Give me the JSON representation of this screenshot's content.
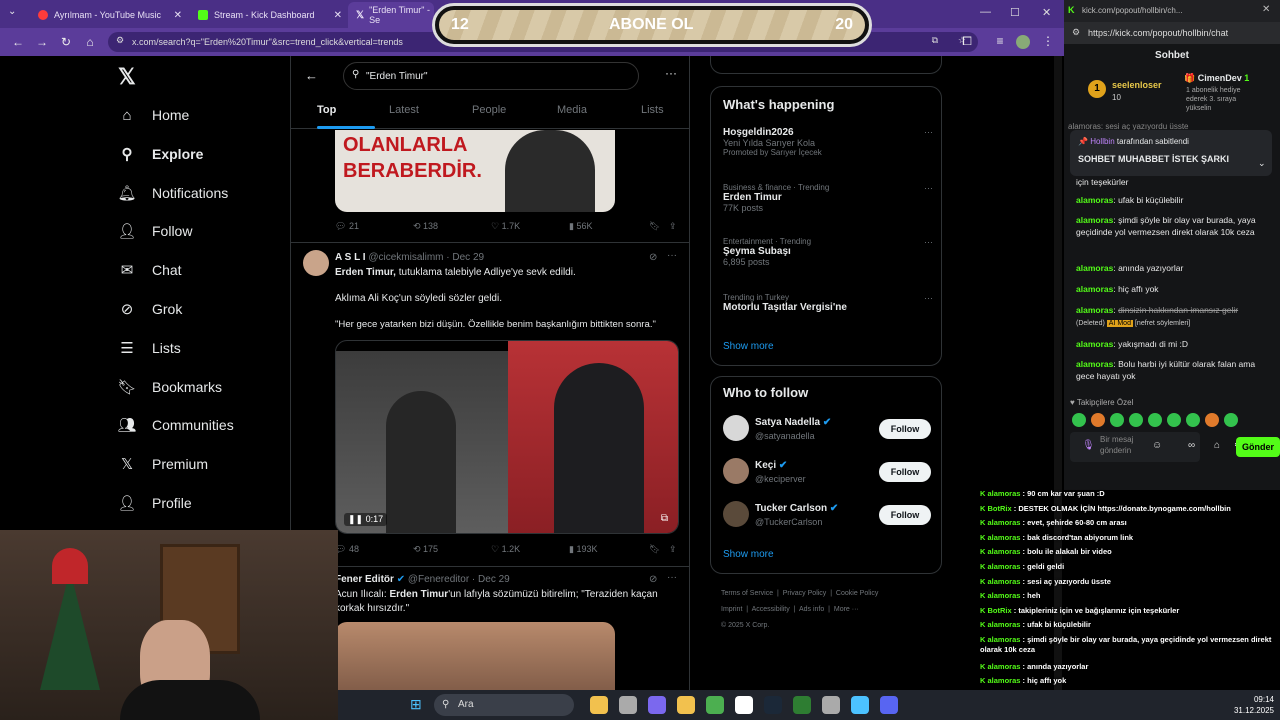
{
  "browser": {
    "tabs": [
      {
        "title": "Ayrılmam - YouTube Music",
        "color": "#ff3b3b"
      },
      {
        "title": "Stream - Kick Dashboard",
        "color": "#53fc18"
      },
      {
        "title": "\"Erden Timur\" - Se",
        "color": "#000000"
      }
    ],
    "url": "x.com/search?q=\"Erden%20Timur\"&src=trend_click&vertical=trends"
  },
  "overlay": {
    "left": "12",
    "label": "ABONE OL",
    "right": "20"
  },
  "x": {
    "nav": [
      {
        "label": "Home",
        "icon": "home-icon"
      },
      {
        "label": "Explore",
        "icon": "search-icon",
        "bold": true
      },
      {
        "label": "Notifications",
        "icon": "bell-icon"
      },
      {
        "label": "Follow",
        "icon": "add-user-icon"
      },
      {
        "label": "Chat",
        "icon": "mail-icon"
      },
      {
        "label": "Grok",
        "icon": "grok-icon"
      },
      {
        "label": "Lists",
        "icon": "list-icon"
      },
      {
        "label": "Bookmarks",
        "icon": "bookmark-icon"
      },
      {
        "label": "Communities",
        "icon": "community-icon"
      },
      {
        "label": "Premium",
        "icon": "x-icon"
      },
      {
        "label": "Profile",
        "icon": "profile-icon"
      }
    ],
    "search_value": "\"Erden Timur\"",
    "tabs": [
      "Top",
      "Latest",
      "People",
      "Media",
      "Lists"
    ],
    "tweet0": {
      "sign": "OLANLARLA\nBERABERDİR.",
      "stats": [
        "21",
        "138",
        "1.7K",
        "56K"
      ]
    },
    "tweet1": {
      "name": "A S L I",
      "handle": "@cicekmisalimm · Dec 29",
      "line1_bold": "Erden Timur,",
      "line1_rest": " tutuklama talebiyle Adliye'ye sevk edildi.",
      "line2": "Aklıma Ali Koç'un söyledi sözler geldi.",
      "line3": "\"Her gece yatarken bizi düşün. Özellikle benim başkanlığım bittikten sonra.\"",
      "video_time": "0:17",
      "stats": [
        "48",
        "175",
        "1.2K",
        "193K"
      ]
    },
    "tweet2": {
      "name": "Fener Editör",
      "handle": "@Fenereditor · Dec 29",
      "text1": "Acun Ilıcalı: ",
      "text1_bold": "Erden Timur",
      "text1_rest": "'un lafıyla sözümüzü bitirelim; \"Teraziden kaçan",
      "text2": "korkak hırsızdır.\""
    },
    "happening": {
      "title": "What's happening",
      "items": [
        {
          "top": "",
          "name": "Hoşgeldin2026",
          "sub": "Yeni Yılda Sarıyer Kola",
          "extra": "Promoted by Sarıyer İçecek"
        },
        {
          "top": "Business & finance · Trending",
          "name": "Erden Timur",
          "sub": "77K posts",
          "extra": ""
        },
        {
          "top": "Entertainment · Trending",
          "name": "Şeyma Subaşı",
          "sub": "6,895 posts",
          "extra": ""
        },
        {
          "top": "Trending in Turkey",
          "name": "Motorlu Taşıtlar Vergisi'ne",
          "sub": "",
          "extra": ""
        }
      ],
      "show_more": "Show more"
    },
    "who": {
      "title": "Who to follow",
      "items": [
        {
          "name": "Satya Nadella",
          "handle": "@satyanadella"
        },
        {
          "name": "Keçi",
          "handle": "@keciperver"
        },
        {
          "name": "Tucker Carlson",
          "handle": "@TuckerCarlson"
        }
      ],
      "button": "Follow",
      "show_more": "Show more"
    },
    "footer": [
      "Terms of Service",
      "Privacy Policy",
      "Cookie Policy",
      "Imprint",
      "Accessibility",
      "Ads info",
      "More ···",
      "© 2025 X Corp."
    ]
  },
  "kick": {
    "url": "kick.com/popout/hollbin/ch...",
    "url_full": "https://kick.com/popout/hollbin/chat",
    "title": "Sohbet",
    "top_user": "seelenloser",
    "top_count": "10",
    "gifter": "CimenDev",
    "gift_count": "1",
    "gift_note": "1 abonelik hediye ederek 3. sıraya yükselin",
    "pinned_by": "Hollbin",
    "pinned_label": "tarafından sabitlendi",
    "pinned_text": "SOHBET MUHABBET İSTEK ŞARKI",
    "cut_top": "alamoras: sesi aç yazıyordu üsste",
    "cut2": "için teşekürler",
    "messages": [
      {
        "user": "alamoras",
        "text": "ufak bi küçülebilir"
      },
      {
        "user": "alamoras",
        "text": "şimdi şöyle bir olay var burada, yaya geçidinde yol vermezsen direkt olarak 10k ceza"
      },
      {
        "user": "alamoras",
        "text": "anında yazıyorlar"
      },
      {
        "user": "alamoras",
        "text": "hiç affı yok"
      },
      {
        "user": "alamoras",
        "text": "dinsizin hakkından imansız gelir"
      },
      {
        "user": "alamoras",
        "text": "yakışmadı di mi :D"
      },
      {
        "user": "alamoras",
        "text": "Bolu harbi iyi kültür olarak falan ama gece hayatı yok"
      }
    ],
    "deleted": "(Deleted)",
    "aimod": "AI Mod",
    "reason": "[nefret söylemleri]",
    "followers_only": "Takipçilere Özel",
    "input_placeholder": "Bir mesaj gönderin",
    "send": "Gönder"
  },
  "chat_overlay": [
    {
      "user": "alamoras",
      "text": "90 cm kar var şuan :D"
    },
    {
      "user": "BotRix",
      "text": "DESTEK OLMAK İÇİN https://donate.bynogame.com/hollbin"
    },
    {
      "user": "alamoras",
      "text": "evet, şehirde 60-80 cm arası"
    },
    {
      "user": "alamoras",
      "text": "bak discord'tan abiyorum link"
    },
    {
      "user": "alamoras",
      "text": "bolu ile alakalı bir video"
    },
    {
      "user": "alamoras",
      "text": "geldi geldi"
    },
    {
      "user": "alamoras",
      "text": "sesi aç yazıyordu üsste"
    },
    {
      "user": "alamoras",
      "text": "heh"
    },
    {
      "user": "BotRix",
      "text": "takipleriniz için ve bağışlarınız için teşekürler"
    },
    {
      "user": "alamoras",
      "text": "ufak bi küçülebilir"
    },
    {
      "user": "alamoras",
      "text": "şimdi şöyle bir olay var burada, yaya geçidinde yol vermezsen direkt olarak 10k ceza"
    },
    {
      "user": "alamoras",
      "text": "anında yazıyorlar"
    },
    {
      "user": "alamoras",
      "text": "hiç affı yok"
    },
    {
      "user": "alamoras",
      "text": "yakışmadı di mi :D"
    },
    {
      "user": "alamoras",
      "text": "Bolu harbi iyi kültür olarak falan ama gece hayatı yok"
    }
  ],
  "taskbar": {
    "search": "Ara",
    "time": "09:14",
    "date": "31.12.2025"
  }
}
